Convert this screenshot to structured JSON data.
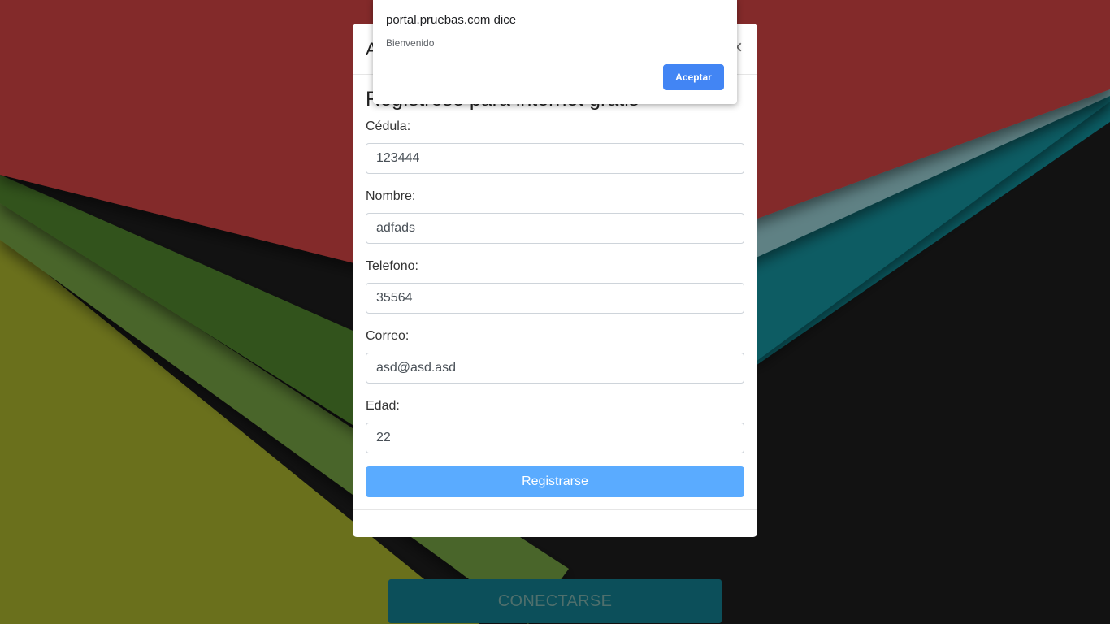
{
  "background": {
    "colors": {
      "red": "#832a2b",
      "dark_green": "#33531e",
      "mid_green": "#486529",
      "olive": "#6a701f",
      "grey_teal": "#5e8184",
      "teal": "#0b5c63",
      "black": "#121212"
    }
  },
  "connect_button": {
    "label": "CONECTARSE",
    "bg_color": "#0c4f5a"
  },
  "modal": {
    "title": "A",
    "close_glyph": "×",
    "form_heading": "Regístrese para internet gratis",
    "fields": [
      {
        "label": "Cédula:",
        "value": "123444"
      },
      {
        "label": "Nombre:",
        "value": "adfads"
      },
      {
        "label": "Telefono:",
        "value": "35564"
      },
      {
        "label": "Correo:",
        "value": "asd@asd.asd"
      },
      {
        "label": "Edad:",
        "value": "22"
      }
    ],
    "submit_label": "Registrarse",
    "submit_color": "#5aabff"
  },
  "alert": {
    "title": "portal.pruebas.com dice",
    "message": "Bienvenido",
    "ok_label": "Aceptar",
    "ok_color": "#4285f4"
  }
}
